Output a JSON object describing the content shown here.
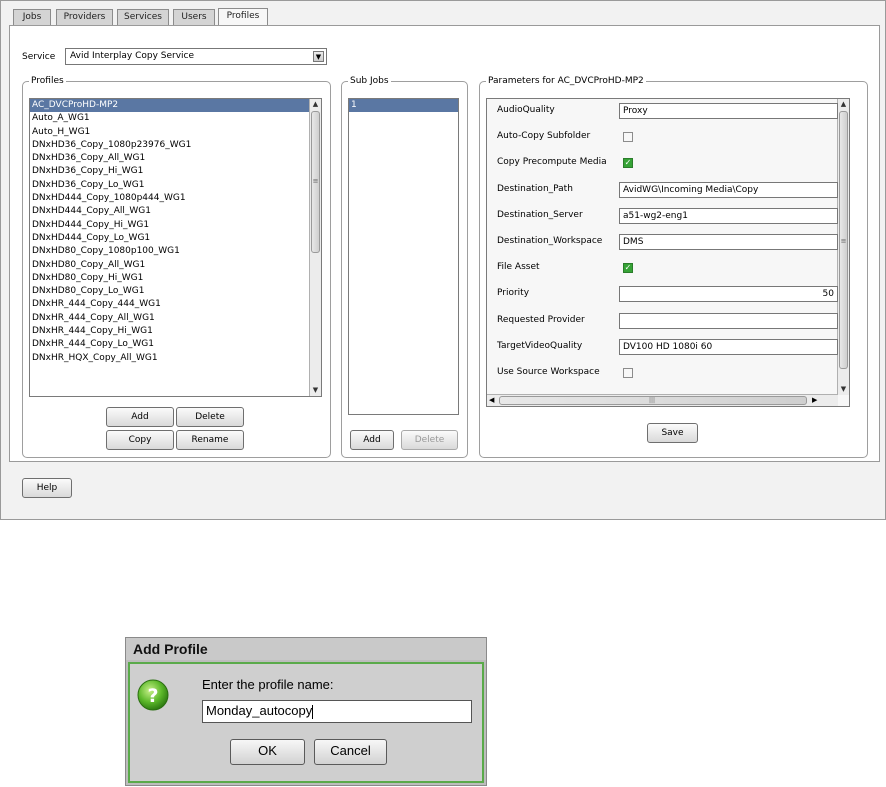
{
  "tabs": [
    {
      "label": "Jobs"
    },
    {
      "label": "Providers"
    },
    {
      "label": "Services"
    },
    {
      "label": "Users"
    },
    {
      "label": "Profiles"
    }
  ],
  "active_tab": "Profiles",
  "service": {
    "label": "Service",
    "value": "Avid Interplay Copy Service"
  },
  "profiles": {
    "title": "Profiles",
    "items": [
      "AC_DVCProHD-MP2",
      "Auto_A_WG1",
      "Auto_H_WG1",
      "DNxHD36_Copy_1080p23976_WG1",
      "DNxHD36_Copy_All_WG1",
      "DNxHD36_Copy_Hi_WG1",
      "DNxHD36_Copy_Lo_WG1",
      "DNxHD444_Copy_1080p444_WG1",
      "DNxHD444_Copy_All_WG1",
      "DNxHD444_Copy_Hi_WG1",
      "DNxHD444_Copy_Lo_WG1",
      "DNxHD80_Copy_1080p100_WG1",
      "DNxHD80_Copy_All_WG1",
      "DNxHD80_Copy_Hi_WG1",
      "DNxHD80_Copy_Lo_WG1",
      "DNxHR_444_Copy_444_WG1",
      "DNxHR_444_Copy_All_WG1",
      "DNxHR_444_Copy_Hi_WG1",
      "DNxHR_444_Copy_Lo_WG1",
      "DNxHR_HQX_Copy_All_WG1"
    ],
    "selected": "AC_DVCProHD-MP2",
    "buttons": {
      "add": "Add",
      "delete": "Delete",
      "copy": "Copy",
      "rename": "Rename"
    }
  },
  "subjobs": {
    "title": "Sub Jobs",
    "items": [
      "1"
    ],
    "buttons": {
      "add": "Add",
      "delete": "Delete"
    }
  },
  "parameters": {
    "title": "Parameters for AC_DVCProHD-MP2",
    "rows": [
      {
        "label": "AudioQuality",
        "type": "text",
        "value": "Proxy"
      },
      {
        "label": "Auto-Copy Subfolder",
        "type": "check",
        "checked": false
      },
      {
        "label": "Copy Precompute Media",
        "type": "check",
        "checked": true
      },
      {
        "label": "Destination_Path",
        "type": "text",
        "value": "AvidWG\\Incoming Media\\Copy"
      },
      {
        "label": "Destination_Server",
        "type": "text",
        "value": "a51-wg2-eng1"
      },
      {
        "label": "Destination_Workspace",
        "type": "text",
        "value": "DMS"
      },
      {
        "label": "File Asset",
        "type": "check",
        "checked": true
      },
      {
        "label": "Priority",
        "type": "number",
        "value": "50"
      },
      {
        "label": "Requested Provider",
        "type": "text",
        "value": ""
      },
      {
        "label": "TargetVideoQuality",
        "type": "text",
        "value": "DV100 HD 1080i 60"
      },
      {
        "label": "Use Source Workspace",
        "type": "check",
        "checked": false
      }
    ],
    "save_label": "Save"
  },
  "help_label": "Help",
  "dialog": {
    "title": "Add Profile",
    "prompt": "Enter the profile name:",
    "input_value": "Monday_autocopy",
    "ok_label": "OK",
    "cancel_label": "Cancel",
    "icon": "question-icon"
  }
}
